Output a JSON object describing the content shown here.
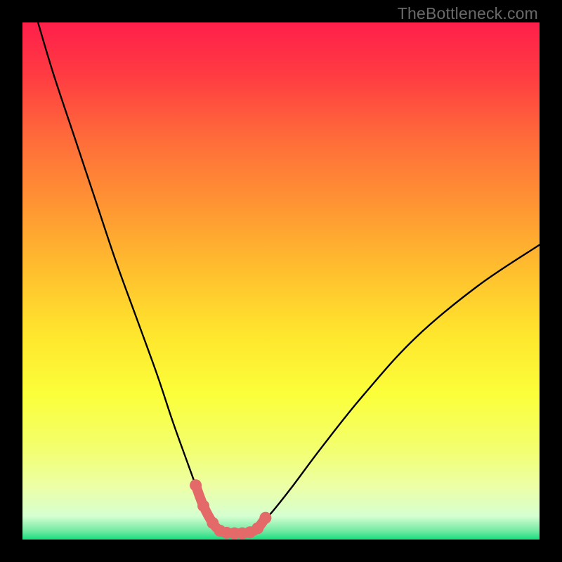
{
  "watermark": {
    "text": "TheBottleneck.com"
  },
  "gradient": {
    "stops": [
      {
        "offset": 0.0,
        "color": "#ff1f4b"
      },
      {
        "offset": 0.1,
        "color": "#ff3b42"
      },
      {
        "offset": 0.22,
        "color": "#ff6a3a"
      },
      {
        "offset": 0.35,
        "color": "#ff9433"
      },
      {
        "offset": 0.48,
        "color": "#ffbf2e"
      },
      {
        "offset": 0.6,
        "color": "#ffe52d"
      },
      {
        "offset": 0.72,
        "color": "#fbff3a"
      },
      {
        "offset": 0.82,
        "color": "#f3ff6c"
      },
      {
        "offset": 0.9,
        "color": "#ecffa8"
      },
      {
        "offset": 0.955,
        "color": "#d5ffd0"
      },
      {
        "offset": 0.985,
        "color": "#6be8a0"
      },
      {
        "offset": 1.0,
        "color": "#16de80"
      }
    ]
  },
  "chart_data": {
    "type": "line",
    "title": "",
    "xlabel": "",
    "ylabel": "",
    "xlim": [
      0,
      100
    ],
    "ylim": [
      0,
      100
    ],
    "grid": false,
    "legend": false,
    "series": [
      {
        "name": "bottleneck-curve",
        "color": "#000000",
        "x": [
          3,
          6,
          10,
          14,
          18,
          22,
          26,
          29,
          31.5,
          33.5,
          35,
          36.5,
          38,
          40,
          42,
          43.5,
          45,
          48,
          52,
          58,
          66,
          76,
          88,
          100
        ],
        "y": [
          100,
          90,
          78,
          66,
          54,
          43,
          32,
          23,
          16,
          10.5,
          6.5,
          3.5,
          1.8,
          1.0,
          1.0,
          1.2,
          2.0,
          5.0,
          10,
          18,
          28,
          39,
          49,
          57
        ]
      },
      {
        "name": "optimal-range-markers",
        "color": "#e46a6a",
        "x": [
          33.5,
          35.0,
          36.8,
          38.2,
          39.5,
          41.0,
          42.5,
          44.0,
          45.5,
          47.0
        ],
        "y": [
          10.5,
          6.5,
          3.2,
          1.7,
          1.3,
          1.2,
          1.2,
          1.4,
          2.2,
          4.2
        ]
      }
    ]
  }
}
